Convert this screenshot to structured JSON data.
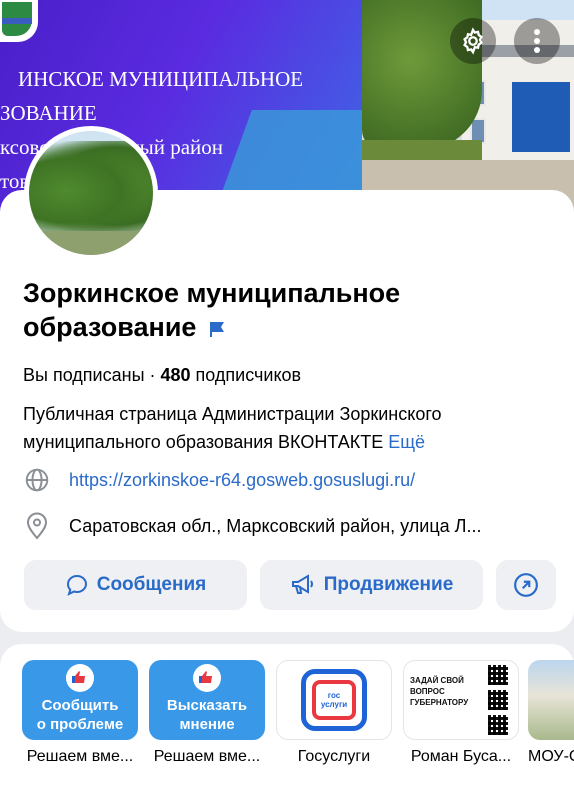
{
  "cover": {
    "text_lines": [
      "ИНСКОЕ МУНИЦИПАЛЬНОЕ",
      "ЗОВАНИЕ",
      "ксовс       иципальный район",
      "тов             ь"
    ],
    "colors": {
      "primary": "#5a2be0",
      "accent": "#3a9bd8"
    },
    "settings_icon": "gear-icon",
    "menu_icon": "more-vertical-icon"
  },
  "profile": {
    "title": "Зоркинское  муниципальное образование",
    "verified_icon": "verified-flag-icon",
    "subscribed": "Вы подписаны",
    "separator": " · ",
    "subscribers_count": "480",
    "subscribers_label": " подписчиков",
    "description": "Публичная страница Администрации Зоркинского муниципального образования ВКОНТАКТЕ ",
    "more_label": "Ещё",
    "website": "https://zorkinskoe-r64.gosweb.gosuslugi.ru/",
    "website_icon": "globe-icon",
    "address": "Саратовская обл., Марксовский район, улица Л...",
    "address_icon": "location-pin-icon"
  },
  "actions": {
    "messages_label": "Сообщения",
    "promotion_label": "Продвижение",
    "accent": "#2a6ac9"
  },
  "services": [
    {
      "tile_text_1": "Сообщить",
      "tile_text_2": "о проблеме",
      "caption": "Решаем вме..."
    },
    {
      "tile_text_1": "Высказать",
      "tile_text_2": "мнение",
      "caption": "Решаем вме..."
    },
    {
      "tile_text_1": "гос",
      "tile_text_2": "услуги",
      "caption": "Госуслуги"
    },
    {
      "tile_text_1": "ЗАДАЙ СВОЙ ВОПРОС ГУБЕРНАТОРУ",
      "tile_text_2": "",
      "caption": "Роман Буса..."
    },
    {
      "tile_text_1": "",
      "tile_text_2": "",
      "caption": "МОУ-С"
    }
  ]
}
